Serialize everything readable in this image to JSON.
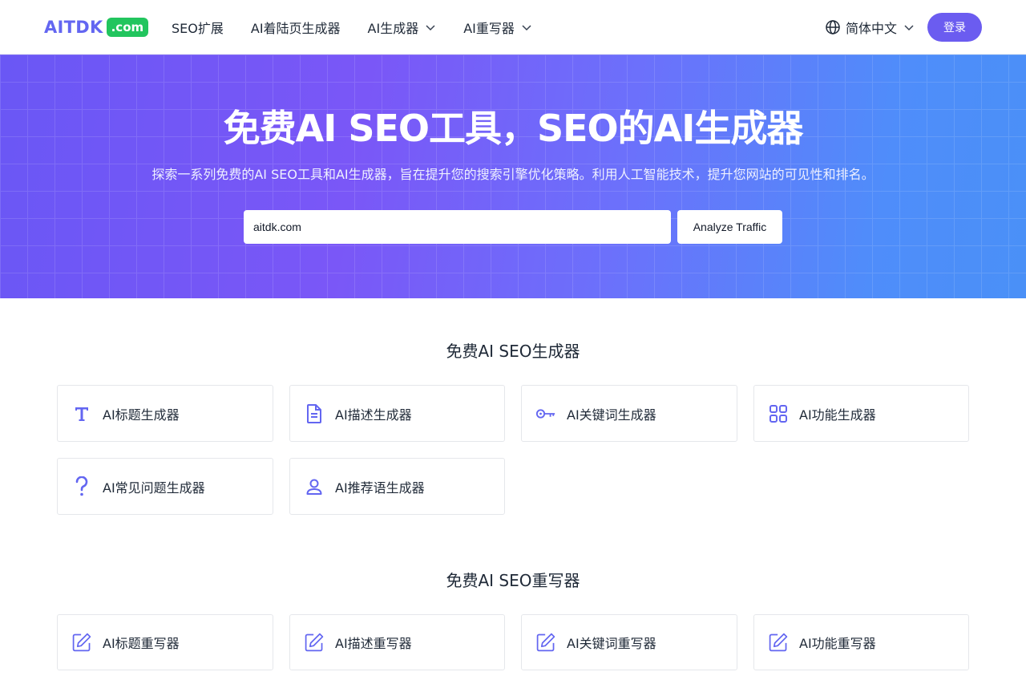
{
  "header": {
    "logo_text": "AITDK",
    "logo_badge": ".com",
    "nav": [
      {
        "label": "SEO扩展"
      },
      {
        "label": "AI着陆页生成器"
      },
      {
        "label": "AI生成器"
      },
      {
        "label": "AI重写器"
      }
    ],
    "language": "简体中文",
    "login_label": "登录"
  },
  "hero": {
    "title": "免费AI SEO工具，SEO的AI生成器",
    "subtitle": "探索一系列免费的AI SEO工具和AI生成器，旨在提升您的搜索引擎优化策略。利用人工智能技术，提升您网站的可见性和排名。",
    "search_value": "aitdk.com",
    "analyze_label": "Analyze Traffic"
  },
  "generators": {
    "title": "免费AI SEO生成器",
    "items": [
      {
        "label": "AI标题生成器",
        "icon": "text-t-icon"
      },
      {
        "label": "AI描述生成器",
        "icon": "document-icon"
      },
      {
        "label": "AI关键词生成器",
        "icon": "key-icon"
      },
      {
        "label": "AI功能生成器",
        "icon": "grid-icon"
      },
      {
        "label": "AI常见问题生成器",
        "icon": "question-icon"
      },
      {
        "label": "AI推荐语生成器",
        "icon": "user-icon"
      }
    ]
  },
  "rewriters": {
    "title": "免费AI SEO重写器",
    "items": [
      {
        "label": "AI标题重写器",
        "icon": "edit-icon"
      },
      {
        "label": "AI描述重写器",
        "icon": "edit-icon"
      },
      {
        "label": "AI关键词重写器",
        "icon": "edit-icon"
      },
      {
        "label": "AI功能重写器",
        "icon": "edit-icon"
      }
    ]
  },
  "colors": {
    "accent": "#6b5cf0",
    "icon": "#6366f1",
    "badge": "#22c55e"
  }
}
